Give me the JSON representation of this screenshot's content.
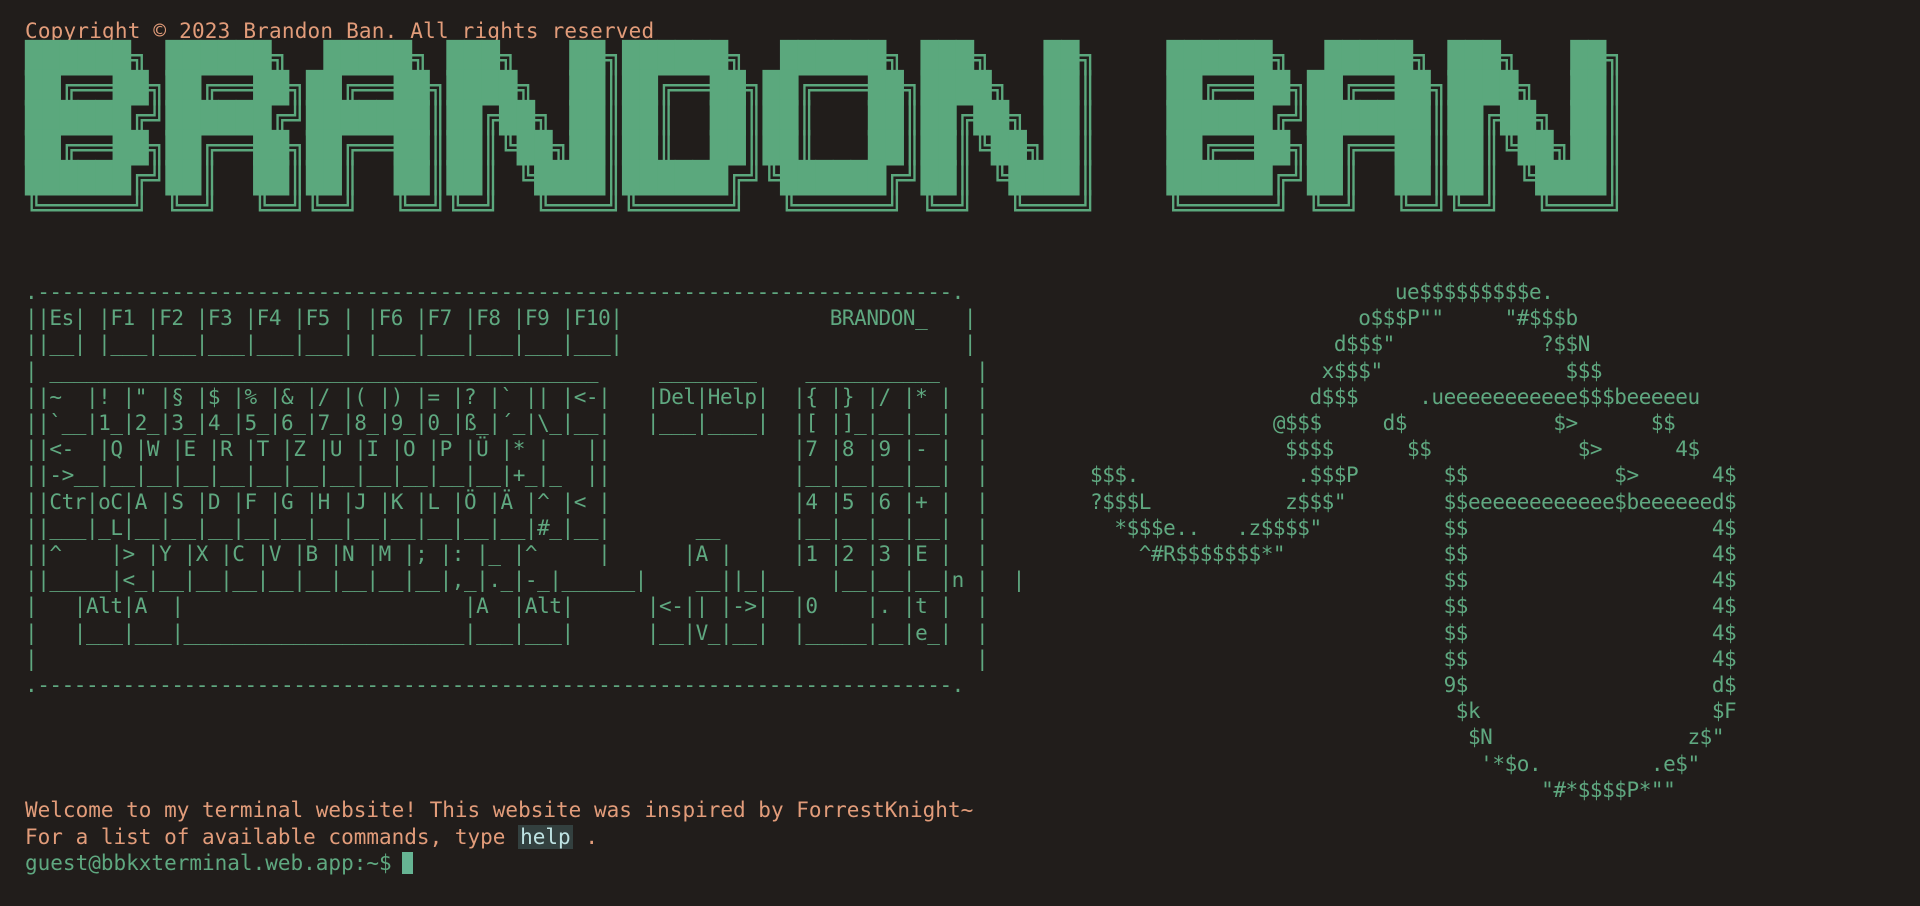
{
  "header": {
    "copyright": "Copyright © 2023 Brandon Ban. All rights reserved"
  },
  "banner": {
    "ascii_art": "██████╗ ██████╗  █████╗ ███╗   ██╗██████╗  ██████╗ ███╗   ██╗    ██████╗  █████╗ ███╗   ██╗\n██╔══██╗██╔══██╗██╔══██╗████╗  ██║██╔══██╗██╔═══██╗████╗  ██║    ██╔══██╗██╔══██╗████╗  ██║\n██████╔╝██████╔╝███████║██╔██╗ ██║██║  ██║██║   ██║██╔██╗ ██║    ██████╔╝███████║██╔██╗ ██║\n██╔══██╗██╔══██╗██╔══██║██║╚██╗██║██║  ██║██║   ██║██║╚██╗██║    ██╔══██╗██╔══██║██║╚██╗██║\n██████╔╝██║  ██║██║  ██║██║ ╚████║██████╔╝╚██████╔╝██║ ╚████║    ██████╔╝██║  ██║██║ ╚████║\n╚═════╝ ╚═╝  ╚═╝╚═╝  ╚═╝╚═╝  ╚═══╝╚═════╝  ╚═════╝ ╚═╝  ╚═══╝    ╚═════╝ ╚═╝  ╚═╝╚═╝  ╚═══╝"
  },
  "keyboard": {
    "ascii_art": ".---------------------------------------------------------------------------.\n||Es| |F1 |F2 |F3 |F4 |F5 | |F6 |F7 |F8 |F9 |F10|                 BRANDON_   |\n||__| |___|___|___|___|___| |___|___|___|___|___|                            |\n| _____________________________________________     ________    ___________   |\n||~  |! |\" |§ |$ |% |& |/ |( |) |= |? |` || |<-|   |Del|Help|  |{ |} |/ |* |  |\n||`__|1_|2_|3_|4_|5_|6_|7_|8_|9_|0_|ß_|´_|\\_|__|   |___|____|  |[ |]_|__|__|  |\n||<-  |Q |W |E |R |T |Z |U |I |O |P |Ü |* |   ||               |7 |8 |9 |- |  |\n||->__|__|__|__|__|__|__|__|__|__|__|__|+_|_  ||               |__|__|__|__|  |\n||Ctr|oC|A |S |D |F |G |H |J |K |L |Ö |Ä |^ |< |               |4 |5 |6 |+ |  |\n||___|_L|__|__|__|__|__|__|__|__|__|__|__|#_|__|       __      |__|__|__|__|  |\n||^    |> |Y |X |C |V |B |N |M |; |: |_ |^     |      |A |     |1 |2 |3 |E |  |\n||_____|<_|__|__|__|__|__|__|__|__|,_|._|-_|______|    __||_|__   |__|__|__|n |  |\n|   |Alt|A  |                       |A  |Alt|      |<-|| |->|  |0    |. |t |  |\n|   |___|___|_______________________|___|___|      |__|V_|__|  |_____|__|e_|  |\n|                                                                             |\n.---------------------------------------------------------------------------."
  },
  "emblem": {
    "ascii_art": "                         ue$$$$$$$$$e.\n                      o$$$P\"\"     \"#$$$b\n                    d$$$\"            ?$$N\n                   x$$$\"               $$$\n                  d$$$     .ueeeeeeeeeee$$$beeeeeu\n               @$$$     d$            $>      $$\n                $$$$      $$            $>      4$\n$$$.             .$$$P       $$            $>      4$\n?$$$L           z$$$\"        $$eeeeeeeeeeee$beeeeeed$\n  *$$$e..   .z$$$$\"          $$                    4$\n    ^#R$$$$$$$*\"             $$                    4$\n                             $$                    4$\n                             $$                    4$\n                             $$                    4$\n                             $$                    4$\n                             9$                    d$\n                              $k                   $F\n                               $N                z$\"\n                                '*$o.         .e$\"\n                                     \"#*$$$$P*\"\""
  },
  "welcome": {
    "line1": "Welcome to my terminal website! This website was inspired by ForrestKnight~",
    "line2_prefix": "For a list of available commands, type ",
    "line2_command": "help",
    "line2_suffix": " ."
  },
  "prompt": {
    "text": "guest@bbkxterminal.web.app:~$"
  },
  "colors": {
    "background": "#211d1b",
    "text_orange": "#e29c7a",
    "accent_green": "#5fa880",
    "cursor": "#66b493"
  }
}
